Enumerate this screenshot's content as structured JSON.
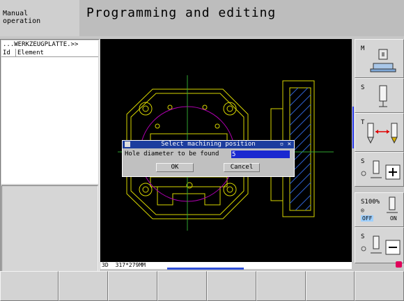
{
  "header": {
    "secondary_mode": "Manual\noperation",
    "primary_mode": "Programming and editing"
  },
  "tree": {
    "path": "...WERKZEUGPLATTE.>>",
    "col_id": "Id",
    "col_element": "Element"
  },
  "dialog": {
    "title": "Select machining position",
    "title_buttons": "▫ ✕",
    "label": "Hole diameter to be found",
    "input_value": "5",
    "ok_label": "OK",
    "cancel_label": "Cancel"
  },
  "status_bar": {
    "mode": "3D",
    "size": "317*279MM"
  },
  "softkeys": {
    "m_label": "M",
    "s_label": "S",
    "t_label": "T",
    "s2_label": "S",
    "override_label": "S100%",
    "off_label": "OFF",
    "on_label": "ON",
    "s3_label": "S"
  },
  "colors": {
    "dialog_title_bg": "#1c3d9e",
    "input_bg": "#1a28d0",
    "drawing_yellow": "#d8d600",
    "drawing_green": "#2fa52f",
    "drawing_magenta": "#b100b1"
  },
  "icons": [
    "machine-icon",
    "spindle-icon",
    "tool-change-icon",
    "plus-icon",
    "minus-icon",
    "coolant-icon",
    "power-icon"
  ]
}
